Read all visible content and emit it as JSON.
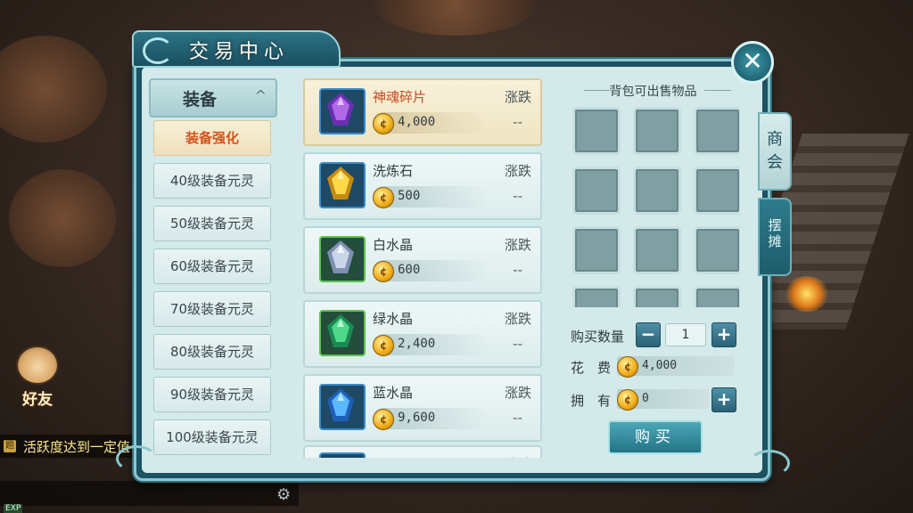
{
  "window": {
    "title": "交易中心",
    "close_symbol": "✕"
  },
  "category": {
    "header": "装备",
    "header_chevron": "^",
    "items": [
      {
        "label": "装备强化",
        "active": true
      },
      {
        "label": "40级装备元灵"
      },
      {
        "label": "50级装备元灵"
      },
      {
        "label": "60级装备元灵"
      },
      {
        "label": "70级装备元灵"
      },
      {
        "label": "80级装备元灵"
      },
      {
        "label": "90级装备元灵"
      },
      {
        "label": "100级装备元灵"
      }
    ]
  },
  "list": {
    "items": [
      {
        "name": "神魂碎片",
        "price": "4,000",
        "trend_label": "涨跌",
        "trend": "--",
        "icon": "purple-spirit-icon",
        "selected": true
      },
      {
        "name": "洗炼石",
        "price": "500",
        "trend_label": "涨跌",
        "trend": "--",
        "icon": "gold-crystal-icon"
      },
      {
        "name": "白水晶",
        "price": "600",
        "trend_label": "涨跌",
        "trend": "--",
        "icon": "white-crystal-icon"
      },
      {
        "name": "绿水晶",
        "price": "2,400",
        "trend_label": "涨跌",
        "trend": "--",
        "icon": "green-crystal-icon"
      },
      {
        "name": "蓝水晶",
        "price": "9,600",
        "trend_label": "涨跌",
        "trend": "--",
        "icon": "blue-crystal-icon"
      }
    ],
    "partial_trend_label": "涨跌"
  },
  "bag": {
    "title": "背包可出售物品"
  },
  "tabs": {
    "shop": "商会",
    "stall": "摆摊"
  },
  "purchase": {
    "qty_label": "购买数量",
    "qty_value": "1",
    "cost_label": "花　费",
    "cost_value": "4,000",
    "own_label": "拥　有",
    "own_value": "0",
    "buy_label": "购买",
    "minus": "−",
    "plus": "+"
  },
  "hud": {
    "friend_label": "好友",
    "chat_tag": "题",
    "chat_text": "活跃度达到一定值",
    "exp_label": "EXP",
    "gear_symbol": "⚙"
  },
  "coin_symbol": "¢",
  "colors": {
    "panel_teal": "#1d5263",
    "active_text": "#d0541e",
    "coin_gold": "#f1b21c"
  }
}
